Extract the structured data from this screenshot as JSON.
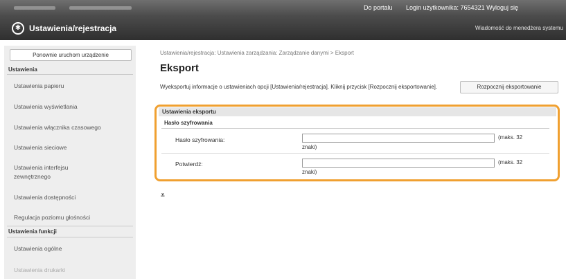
{
  "header": {
    "portal_link": "Do portalu",
    "login_text": "Login użytkownika:  7654321  Wyloguj się",
    "app_title": "Ustawienia/rejestracja",
    "admin_message": "Wiadomość do menedżera systemu"
  },
  "sidebar": {
    "restart_button": "Ponownie uruchom urządzenie",
    "section_settings": "Ustawienia",
    "settings_items": [
      "Ustawienia papieru",
      "Ustawienia wyświetlania",
      "Ustawienia włącznika czasowego",
      "Ustawienia sieciowe",
      "Ustawienia interfejsu zewnętrznego",
      "Ustawienia dostępności",
      "Regulacja poziomu głośności"
    ],
    "section_function": "Ustawienia funkcji",
    "function_items": [
      "Ustawienia ogólne",
      "Ustawienia drukarki"
    ]
  },
  "main": {
    "breadcrumb": "Ustawienia/rejestracja: Ustawienia zarządzania: Zarządzanie danymi > Eksport",
    "title": "Eksport",
    "description": "Wyeksportuj informacje o ustawieniach opcji [Ustawienia/rejestracja]. Kliknij przycisk [Rozpocznij eksportowanie].",
    "start_button": "Rozpocznij eksportowanie",
    "panel_title": "Ustawienia eksportu",
    "subsection": "Hasło szyfrowania",
    "rows": [
      {
        "label": "Hasło szyfrowania:",
        "value": "",
        "hint_a": "(maks. 32",
        "hint_b": "znaki)"
      },
      {
        "label": "Potwierdź:",
        "value": "",
        "hint_a": "(maks. 32",
        "hint_b": "znaki)"
      }
    ],
    "to_top_icon": "to-top-icon",
    "to_top_glyph": "⩡"
  },
  "colors": {
    "highlight": "#f0a030",
    "topbar": "#5a5a5a",
    "titlebar": "#3a3a3a",
    "sidebar_bg": "#eeeeee"
  }
}
